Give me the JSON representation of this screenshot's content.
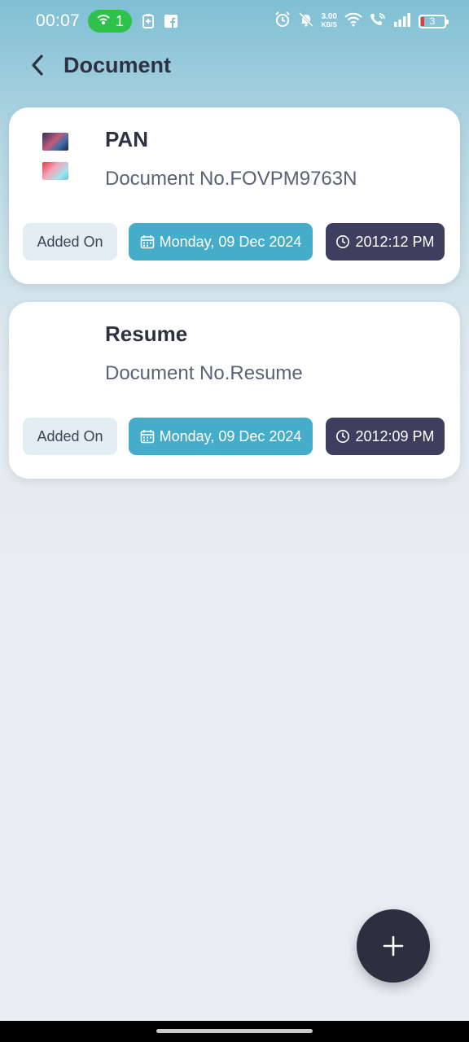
{
  "status_bar": {
    "time": "00:07",
    "hotspot_count": "1",
    "net_speed_value": "3.00",
    "net_speed_unit": "KB/S",
    "battery_level": "3",
    "icons": [
      "hotspot-icon",
      "battery-saver-icon",
      "facebook-icon",
      "alarm-icon",
      "mute-icon",
      "wifi-icon",
      "wifi-call-icon",
      "signal-icon",
      "battery-icon"
    ]
  },
  "header": {
    "title": "Document",
    "back_icon": "chevron-left-icon"
  },
  "documents": [
    {
      "title": "PAN",
      "number": "Document No.FOVPM9763N",
      "has_thumbnails": true,
      "added_label": "Added On",
      "date": "Monday, 09 Dec 2024",
      "time": "2012:12 PM"
    },
    {
      "title": "Resume",
      "number": "Document No.Resume",
      "has_thumbnails": false,
      "added_label": "Added On",
      "date": "Monday, 09 Dec 2024",
      "time": "2012:09 PM"
    }
  ],
  "fab": {
    "icon": "plus-icon"
  },
  "colors": {
    "accent_date": "#45acc9",
    "time_chip": "#3e3f5e",
    "fab": "#2d2e3f",
    "title_text": "#2d3142",
    "hotspot": "#2fc24a"
  }
}
